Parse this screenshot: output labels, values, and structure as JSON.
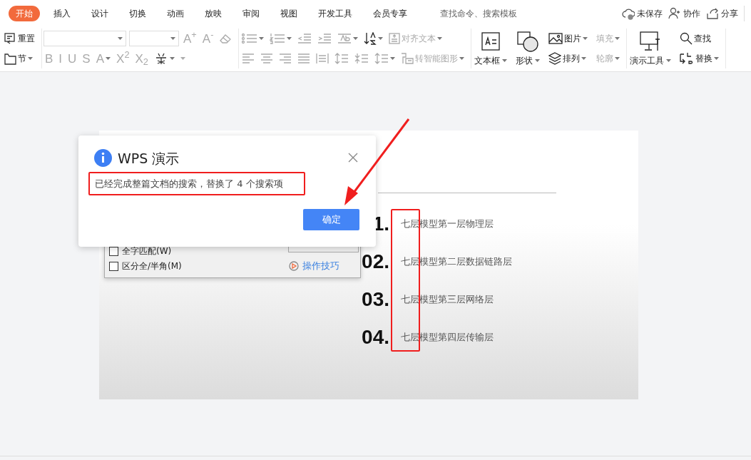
{
  "menu_tabs": [
    {
      "label": "开始",
      "selected": true
    },
    {
      "label": "插入",
      "selected": false
    },
    {
      "label": "设计",
      "selected": false
    },
    {
      "label": "切换",
      "selected": false
    },
    {
      "label": "动画",
      "selected": false
    },
    {
      "label": "放映",
      "selected": false
    },
    {
      "label": "审阅",
      "selected": false
    },
    {
      "label": "视图",
      "selected": false
    },
    {
      "label": "开发工具",
      "selected": false
    },
    {
      "label": "会员专享",
      "selected": false
    }
  ],
  "search": {
    "placeholder": "查找命令、搜索模板"
  },
  "top_actions": [
    {
      "label": "未保存"
    },
    {
      "label": "协作"
    },
    {
      "label": "分享"
    }
  ],
  "ribbon": [
    {
      "columns": [
        {
          "kind": "stack",
          "top": [
            {
              "kind": "icon",
              "label": "重置",
              "dropdown": false,
              "disabled": false
            }
          ],
          "bottom": [
            {
              "kind": "icon",
              "label": "节",
              "dropdown": true,
              "disabled": false
            }
          ]
        }
      ]
    },
    {
      "columns": [
        {
          "kind": "stack",
          "top": [
            {
              "kind": "combo"
            },
            {
              "kind": "combo"
            },
            {
              "kind": "glyph",
              "label": "A$^{+}$",
              "dropdown": false,
              "disabled": true
            },
            {
              "kind": "glyph",
              "label": "A$^{-}$",
              "dropdown": false,
              "disabled": true
            },
            {
              "kind": "icon",
              "dropdown": false,
              "disabled": true
            }
          ],
          "bottom": [
            {
              "kind": "glyph",
              "label": "B",
              "dropdown": false,
              "disabled": true
            },
            {
              "kind": "glyph",
              "label": "I",
              "dropdown": false,
              "disabled": true
            },
            {
              "kind": "glyph",
              "label": "U",
              "dropdown": false,
              "disabled": true
            },
            {
              "kind": "glyph",
              "label": "S",
              "dropdown": false,
              "disabled": true
            },
            {
              "kind": "glyph",
              "label": "A",
              "dropdown": true,
              "disabled": true
            },
            {
              "kind": "glyph",
              "label": "X$^{2}$",
              "dropdown": false,
              "disabled": true
            },
            {
              "kind": "glyph",
              "label": "X$_{2}$",
              "dropdown": false,
              "disabled": true
            },
            {
              "kind": "icon",
              "dropdown": true,
              "disabled": false
            },
            {
              "kind": "caret",
              "dropdown": true,
              "disabled": true
            }
          ]
        }
      ]
    },
    {
      "columns": [
        {
          "kind": "stack",
          "top": [
            {
              "kind": "icon",
              "dropdown": true,
              "disabled": true
            },
            {
              "kind": "icon",
              "dropdown": true,
              "disabled": true
            },
            {
              "kind": "icon",
              "dropdown": false,
              "disabled": true
            },
            {
              "kind": "icon",
              "dropdown": false,
              "disabled": true
            },
            {
              "kind": "icon",
              "dropdown": true,
              "disabled": true
            },
            {
              "kind": "icon",
              "dropdown": true,
              "disabled": false
            },
            {
              "kind": "icon",
              "label": "对齐文本",
              "dropdown": true,
              "disabled": true
            }
          ],
          "bottom": [
            {
              "kind": "icon",
              "dropdown": false,
              "disabled": true
            },
            {
              "kind": "icon",
              "dropdown": false,
              "disabled": true
            },
            {
              "kind": "icon",
              "dropdown": false,
              "disabled": true
            },
            {
              "kind": "icon",
              "dropdown": false,
              "disabled": true
            },
            {
              "kind": "icon",
              "dropdown": false,
              "disabled": true
            },
            {
              "kind": "icon",
              "dropdown": false,
              "disabled": true
            },
            {
              "kind": "icon",
              "dropdown": false,
              "disabled": true
            },
            {
              "kind": "icon",
              "dropdown": true,
              "disabled": true
            },
            {
              "kind": "icon",
              "label": "转智能图形",
              "dropdown": true,
              "disabled": true
            }
          ]
        }
      ]
    },
    {
      "columns": [
        {
          "kind": "large",
          "label": "文本框",
          "dropdown": true,
          "disabled": false
        },
        {
          "kind": "large",
          "label": "形状",
          "dropdown": true,
          "disabled": false
        },
        {
          "kind": "stack",
          "top": [
            {
              "kind": "icon",
              "label": "图片",
              "dropdown": true,
              "disabled": false
            }
          ],
          "bottom": [
            {
              "kind": "icon",
              "label": "排列",
              "dropdown": true,
              "disabled": false
            }
          ]
        },
        {
          "kind": "stack",
          "top": [
            {
              "kind": "text",
              "label": "填充",
              "dropdown": true,
              "disabled": true
            }
          ],
          "bottom": [
            {
              "kind": "text",
              "label": "轮廓",
              "dropdown": true,
              "disabled": true
            }
          ]
        }
      ]
    },
    {
      "columns": [
        {
          "kind": "large",
          "label": "演示工具",
          "dropdown": true,
          "disabled": false
        },
        {
          "kind": "stack",
          "top": [
            {
              "kind": "icon",
              "label": "查找",
              "dropdown": false,
              "disabled": false
            }
          ],
          "bottom": [
            {
              "kind": "icon",
              "label": "替换",
              "dropdown": true,
              "disabled": false
            }
          ]
        }
      ]
    }
  ],
  "slide": {
    "items": [
      {
        "number": "1.",
        "text": "七层模型第一层物理层"
      },
      {
        "number": "02.",
        "text": "七层模型第二层数据链路层"
      },
      {
        "number": "03.",
        "text": "七层模型第三层网络层"
      },
      {
        "number": "04.",
        "text": "七层模型第四层传输层"
      }
    ]
  },
  "find_dialog": {
    "options": [
      {
        "label": "全字匹配(W)",
        "checked": false
      },
      {
        "label": "区分全/半角(M)",
        "checked": false
      }
    ],
    "link": "操作技巧"
  },
  "message_dialog": {
    "title": "WPS 演示",
    "message": "已经完成整篇文档的搜索，替换了 4 个搜索项",
    "button": "确定"
  }
}
